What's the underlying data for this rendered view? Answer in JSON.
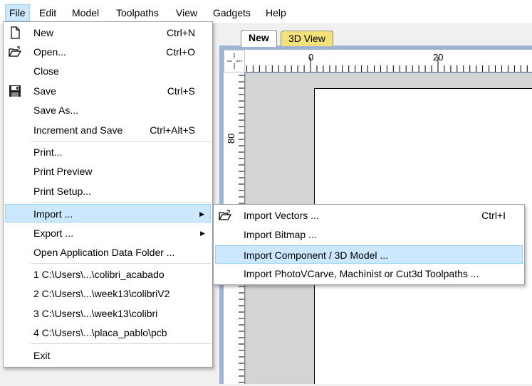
{
  "menubar": [
    "File",
    "Edit",
    "Model",
    "Toolpaths",
    "View",
    "Gadgets",
    "Help"
  ],
  "tabs": {
    "active": "New",
    "other": "3D View"
  },
  "ruler": {
    "top_label_0": "0",
    "top_label_20": "20",
    "left_label_80": "80"
  },
  "file_menu": {
    "items": [
      {
        "label": "New",
        "shortcut": "Ctrl+N",
        "icon": "new-document-icon"
      },
      {
        "label": "Open...",
        "shortcut": "Ctrl+O",
        "icon": "open-folder-icon"
      },
      {
        "label": "Close",
        "shortcut": ""
      },
      {
        "label": "Save",
        "shortcut": "Ctrl+S",
        "icon": "floppy-disk-icon"
      },
      {
        "label": "Save As...",
        "shortcut": ""
      },
      {
        "label": "Increment and Save",
        "shortcut": "Ctrl+Alt+S"
      },
      {
        "label": "Print...",
        "shortcut": ""
      },
      {
        "label": "Print Preview",
        "shortcut": ""
      },
      {
        "label": "Print Setup...",
        "shortcut": ""
      },
      {
        "label": "Import ...",
        "shortcut": "",
        "submenu": true
      },
      {
        "label": "Export ...",
        "shortcut": "",
        "submenu": true
      },
      {
        "label": "Open Application Data Folder ...",
        "shortcut": ""
      },
      {
        "label": "1 C:\\Users\\...\\colibri_acabado",
        "shortcut": ""
      },
      {
        "label": "2 C:\\Users\\...\\week13\\colibriV2",
        "shortcut": ""
      },
      {
        "label": "3 C:\\Users\\...\\week13\\colibri",
        "shortcut": ""
      },
      {
        "label": "4 C:\\Users\\...\\placa_pablo\\pcb",
        "shortcut": ""
      },
      {
        "label": "Exit",
        "shortcut": ""
      }
    ]
  },
  "import_submenu": {
    "items": [
      {
        "label": "Import Vectors ...",
        "shortcut": "Ctrl+I",
        "icon": "open-folder-icon"
      },
      {
        "label": "Import Bitmap ...",
        "shortcut": ""
      },
      {
        "label": "Import Component / 3D Model ...",
        "shortcut": ""
      },
      {
        "label": "Import PhotoVCarve, Machinist or Cut3d Toolpaths ...",
        "shortcut": ""
      }
    ]
  },
  "colors": {
    "highlight": "#cce8ff",
    "highlight_border": "#99d1ff",
    "tab_3d": "#f3e27a",
    "frame": "#9fb4d4"
  }
}
